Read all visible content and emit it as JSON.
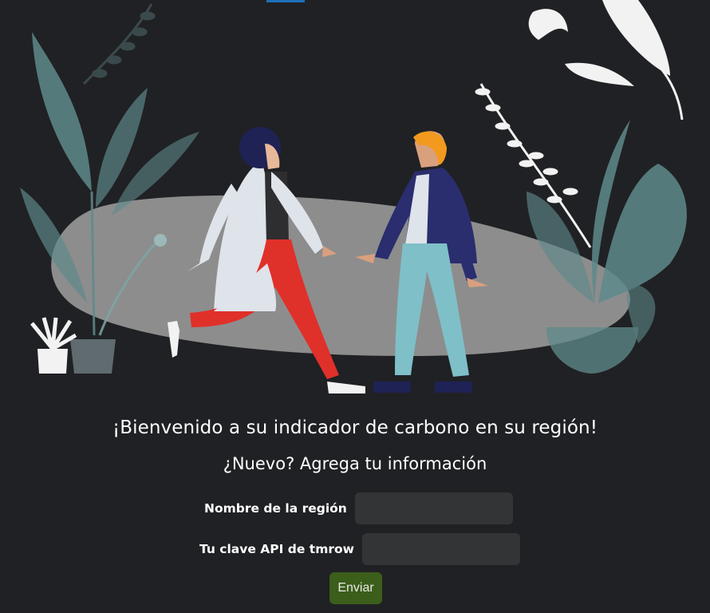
{
  "hero": {
    "illustration": "two-people-greeting-with-plants",
    "colors": {
      "background": "#202124",
      "blob": "#8d8d8d",
      "leaf": "#5f8a8b",
      "coat": "#dfe3ea",
      "pants_red": "#e0302a",
      "jacket_navy": "#2a2d6e",
      "pants_teal": "#7fbfc8",
      "hair_orange": "#f29a1e"
    }
  },
  "content": {
    "welcome": "¡Bienvenido a su indicador de carbono en su región!",
    "subtitle": "¿Nuevo? Agrega tu información"
  },
  "form": {
    "region_label": "Nombre de la región",
    "region_value": "",
    "api_label": "Tu clave API de tmrow",
    "api_value": "",
    "submit_label": "Enviar",
    "submit_color": "#3b5e1a"
  }
}
